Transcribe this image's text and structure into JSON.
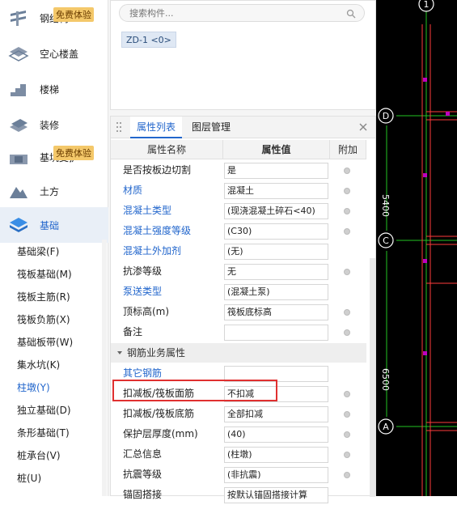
{
  "sidebar": {
    "categories": [
      {
        "label": "钢结构",
        "icon": "steel-structure-icon",
        "badge": "免费体验"
      },
      {
        "label": "空心楼盖",
        "icon": "hollow-floor-icon"
      },
      {
        "label": "楼梯",
        "icon": "stairs-icon"
      },
      {
        "label": "装修",
        "icon": "decoration-icon"
      },
      {
        "label": "基坑支护",
        "icon": "foundation-pit-icon",
        "badge": "免费体验"
      },
      {
        "label": "土方",
        "icon": "earthwork-icon"
      },
      {
        "label": "基础",
        "icon": "foundation-icon"
      }
    ],
    "sub_items": [
      {
        "label": "基础梁(F)"
      },
      {
        "label": "筏板基础(M)"
      },
      {
        "label": "筏板主筋(R)"
      },
      {
        "label": "筏板负筋(X)"
      },
      {
        "label": "基础板带(W)"
      },
      {
        "label": "集水坑(K)"
      },
      {
        "label": "柱墩(Y)"
      },
      {
        "label": "独立基础(D)"
      },
      {
        "label": "条形基础(T)"
      },
      {
        "label": "桩承台(V)"
      },
      {
        "label": "桩(U)"
      }
    ],
    "selected_sub": "柱墩(Y)"
  },
  "component_list": {
    "search_placeholder": "搜索构件...",
    "items": [
      "ZD-1 <0>"
    ]
  },
  "properties": {
    "tabs": [
      "属性列表",
      "图层管理"
    ],
    "columns": [
      "属性名称",
      "属性值",
      "附加"
    ],
    "rows": [
      {
        "name": "是否按板边切割",
        "value": "是",
        "link": false,
        "check": true
      },
      {
        "name": "材质",
        "value": "混凝土",
        "link": true,
        "check": true
      },
      {
        "name": "混凝土类型",
        "value": "(现浇混凝土碎石<40)",
        "link": true,
        "check": true
      },
      {
        "name": "混凝土强度等级",
        "value": "(C30)",
        "link": true,
        "check": true
      },
      {
        "name": "混凝土外加剂",
        "value": "(无)",
        "link": true,
        "check": false
      },
      {
        "name": "抗渗等级",
        "value": "无",
        "link": false,
        "check": true
      },
      {
        "name": "泵送类型",
        "value": "(混凝土泵)",
        "link": true,
        "check": false
      },
      {
        "name": "顶标高(m)",
        "value": "筏板底标高",
        "link": false,
        "check": true
      },
      {
        "name": "备注",
        "value": "",
        "link": false,
        "check": true
      }
    ],
    "group_label": "钢筋业务属性",
    "group_rows": [
      {
        "name": "其它钢筋",
        "value": "",
        "link": true,
        "check": false
      },
      {
        "name": "扣减板/筏板面筋",
        "value": "不扣减",
        "link": false,
        "check": true
      },
      {
        "name": "扣减板/筏板底筋",
        "value": "全部扣减",
        "link": false,
        "check": true
      },
      {
        "name": "保护层厚度(mm)",
        "value": "(40)",
        "link": false,
        "check": true
      },
      {
        "name": "汇总信息",
        "value": "(柱墩)",
        "link": false,
        "check": true
      },
      {
        "name": "抗震等级",
        "value": "(非抗震)",
        "link": false,
        "check": true
      },
      {
        "name": "锚固搭接",
        "value": "按默认锚固搭接计算",
        "link": false,
        "check": false
      }
    ]
  },
  "drawing": {
    "axis_labels": [
      "1",
      "D",
      "C",
      "A"
    ],
    "dimensions": [
      "5400",
      "6500"
    ],
    "grid_color": "#22c322",
    "line_color": "#ff3b3b",
    "marker_color": "#c000c0"
  }
}
